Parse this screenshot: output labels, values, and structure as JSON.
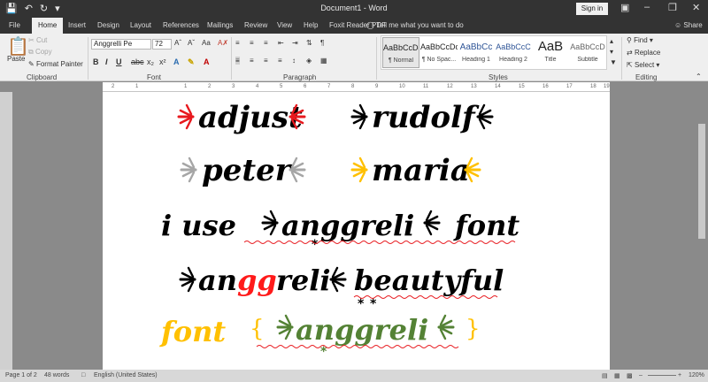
{
  "window": {
    "title": "Document1 - Word",
    "sign_in": "Sign in"
  },
  "tabs": [
    "File",
    "Home",
    "Insert",
    "Design",
    "Layout",
    "References",
    "Mailings",
    "Review",
    "View",
    "Help",
    "Foxit Reader PDF"
  ],
  "tell_me": "Tell me what you want to do",
  "share": "Share",
  "clipboard": {
    "paste": "Paste",
    "cut": "Cut",
    "copy": "Copy",
    "format_painter": "Format Painter",
    "label": "Clipboard"
  },
  "font": {
    "name": "Anggrelli Pe",
    "size": "72",
    "label": "Font"
  },
  "paragraph": {
    "label": "Paragraph"
  },
  "styles": {
    "label": "Styles",
    "items": [
      {
        "preview": "AaBbCcDc",
        "name": "¶ Normal"
      },
      {
        "preview": "AaBbCcDc",
        "name": "¶ No Spac..."
      },
      {
        "preview": "AaBbCc",
        "name": "Heading 1"
      },
      {
        "preview": "AaBbCcC",
        "name": "Heading 2"
      },
      {
        "preview": "AaB",
        "name": "Title"
      },
      {
        "preview": "AaBbCcD",
        "name": "Subtitle"
      }
    ]
  },
  "editing": {
    "find": "Find",
    "replace": "Replace",
    "select": "Select",
    "label": "Editing"
  },
  "ruler_numbers": [
    "2",
    "1",
    "1",
    "2",
    "3",
    "4",
    "5",
    "6",
    "7",
    "8",
    "9",
    "10",
    "11",
    "12",
    "13",
    "14",
    "15",
    "16",
    "17",
    "18",
    "19"
  ],
  "document": {
    "words": [
      {
        "text": "adjust",
        "color": "#000000"
      },
      {
        "text": "rudolf",
        "color": "#000000"
      },
      {
        "text": "peter",
        "color": "#000000"
      },
      {
        "text": "maria",
        "color": "#000000"
      },
      {
        "text": "i use",
        "color": "#000000"
      },
      {
        "text": "anggreli",
        "color": "#000000"
      },
      {
        "text": "font",
        "color": "#000000"
      },
      {
        "text": "an",
        "color": "#000000"
      },
      {
        "text": "gg",
        "color": "#ff1a1a"
      },
      {
        "text": "reli",
        "color": "#000000"
      },
      {
        "text": "beautyful",
        "color": "#000000"
      },
      {
        "text": "font",
        "color": "#ffc000"
      },
      {
        "text": "{",
        "color": "#ffc000"
      },
      {
        "text": "anggreli",
        "color": "#548235"
      },
      {
        "text": "}",
        "color": "#ffc000"
      }
    ],
    "ornament_colors": {
      "red": "#e8191e",
      "gray": "#a6a6a6",
      "yellow": "#ffc000",
      "black": "#000000",
      "green": "#548235"
    }
  },
  "status": {
    "page": "Page 1 of 2",
    "words": "48 words",
    "language": "English (United States)",
    "zoom": "120%"
  }
}
